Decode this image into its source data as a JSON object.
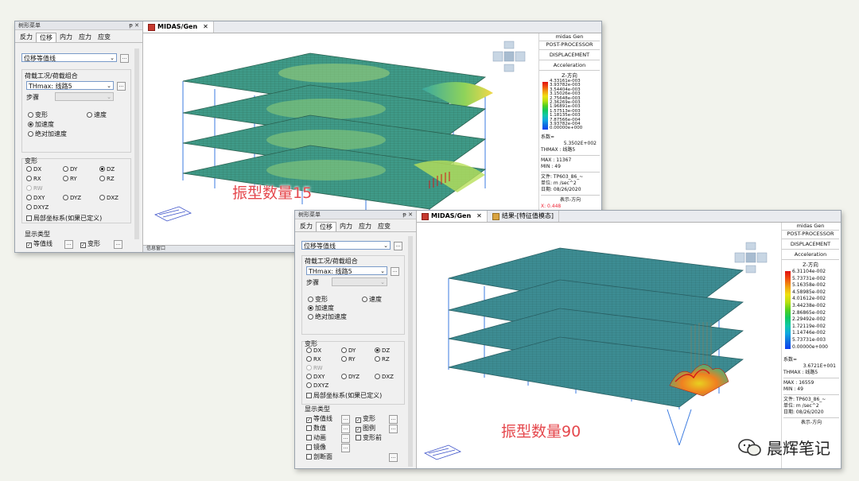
{
  "shot1": {
    "panel_title": "树形菜单",
    "panel_ctrls": "ᵽ ✕",
    "tabs": [
      "反力",
      "位移",
      "内力",
      "应力",
      "应变"
    ],
    "active_tab": 1,
    "result_type": "位移等值线",
    "load_case_title": "荷载工况/荷载组合",
    "load_case_value": "THmax: 线路5",
    "step_label": "步骤",
    "radio_deform": "变形",
    "radio_velocity": "速度",
    "radio_accel": "加速度",
    "radio_abs_accel": "绝对加速度",
    "deform_title": "变形",
    "components": [
      "DX",
      "DY",
      "DZ",
      "RX",
      "RY",
      "RZ"
    ],
    "comp_rw": "RW",
    "comp_row3": [
      "DXY",
      "DYZ",
      "DXZ"
    ],
    "comp_dxyz": "DXYZ",
    "local_axis": "局部坐标系(如果已定义)",
    "display_title": "显示类型",
    "display_items": [
      "等值线",
      "变形"
    ],
    "view_tab": "MIDAS/Gen",
    "bottom_label": "信息窗口",
    "caption": "振型数量15",
    "legend": {
      "brand": "midas Gen",
      "sub": "POST-PROCESSOR",
      "type": "DISPLACEMENT",
      "mode": "Acceleration",
      "dir": "Z-方向",
      "values": [
        "4.33161e-003",
        "3.93782e-003",
        "3.54404e-003",
        "3.15026e-003",
        "2.75648e-003",
        "2.36269e-003",
        "1.96891e-003",
        "1.57513e-003",
        "1.18135e-003",
        "7.87566e-004",
        "3.93782e-004",
        "0.00000e+000"
      ],
      "factor_label": "系数=",
      "factor": "5.3502E+002",
      "thmax": "THMAX : 线路5",
      "max": "MAX : 11367",
      "min": "MIN : 49",
      "file": "文件: TP603_86_~",
      "unit": "单位: m /sec^2",
      "date": "日期: 08/26/2020",
      "view_dir": "表示-方向",
      "coord": "X: 0.448"
    }
  },
  "shot2": {
    "panel_title": "树形菜单",
    "panel_ctrls": "ᵽ ✕",
    "tabs": [
      "反力",
      "位移",
      "内力",
      "应力",
      "应变"
    ],
    "active_tab": 1,
    "result_type": "位移等值线",
    "load_case_title": "荷载工况/荷载组合",
    "load_case_value": "THmax: 线路5",
    "step_label": "步骤",
    "radio_deform": "变形",
    "radio_velocity": "速度",
    "radio_accel": "加速度",
    "radio_abs_accel": "绝对加速度",
    "deform_title": "变形",
    "components": [
      "DX",
      "DY",
      "DZ",
      "RX",
      "RY",
      "RZ"
    ],
    "comp_rw": "RW",
    "comp_row3": [
      "DXY",
      "DYZ",
      "DXZ"
    ],
    "comp_dxyz": "DXYZ",
    "local_axis": "局部坐标系(如果已定义)",
    "display_title": "显示类型",
    "display_items": [
      "等值线",
      "变形",
      "数值",
      "图例",
      "动画",
      "变形前",
      "镜像",
      "剖断面"
    ],
    "view_tab": "MIDAS/Gen",
    "view_tab2": "结果-[特征值模态]",
    "caption": "振型数量90",
    "legend": {
      "brand": "midas Gen",
      "sub": "POST-PROCESSOR",
      "type": "DISPLACEMENT",
      "mode": "Acceleration",
      "dir": "Z-方向",
      "values": [
        "6.31104e-002",
        "5.73731e-002",
        "5.16358e-002",
        "4.58985e-002",
        "4.01612e-002",
        "3.44238e-002",
        "2.86865e-002",
        "2.29492e-002",
        "1.72119e-002",
        "1.14746e-002",
        "5.73731e-003",
        "0.00000e+000"
      ],
      "factor_label": "系数=",
      "factor": "3.6721E+001",
      "thmax": "THMAX : 线路5",
      "max": "MAX : 16559",
      "min": "MIN : 49",
      "file": "文件: TP603_86_~",
      "unit": "单位: m /sec^2",
      "date": "日期: 08/26/2020",
      "view_dir": "表示-方向"
    }
  },
  "watermark": "晨辉笔记"
}
